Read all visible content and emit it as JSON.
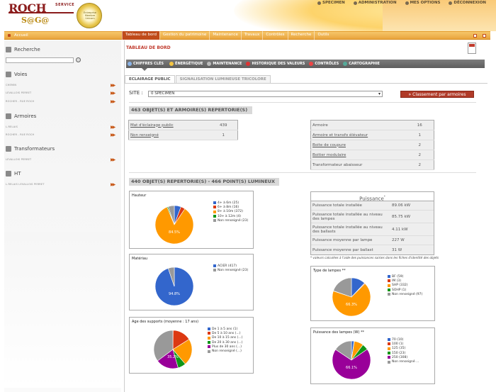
{
  "header": {
    "logo_main": "ROCH",
    "logo_service": "SERVICE",
    "logo_sub": "S@G@",
    "seal_text": "Entreprise Membre Unicom",
    "links": [
      "SPECIMEN",
      "ADMINISTRATION",
      "MES OPTIONS",
      "DÉCONNEXION"
    ]
  },
  "nav": {
    "home": "Accueil",
    "items": [
      "Tableau de bord",
      "Gestion du patrimoine",
      "Maintenance",
      "Travaux",
      "Contrôles",
      "Recherche",
      "Outils"
    ]
  },
  "sidebar": {
    "search_title": "Recherche",
    "sections": [
      {
        "title": "Voies",
        "items": [
          "CHEMIN",
          "LEVALLOIS PERRET",
          "ROCHER - RUE ROCH"
        ]
      },
      {
        "title": "Armoires",
        "items": [
          "L.RELAIS",
          "ROCHER - RUE ROCH"
        ]
      },
      {
        "title": "Transformateurs",
        "items": [
          "LEVALLOIS PERRET"
        ]
      },
      {
        "title": "HT",
        "items": [
          "L.RELAIS LEVALLOIS PERRET"
        ]
      }
    ]
  },
  "main": {
    "page_title": "TABLEAU DE BORD",
    "subtabs": [
      "CHIFFRES CLÉS",
      "ÉNERGÉTIQUE",
      "MAINTENANCE",
      "HISTORIQUE DES VALEURS",
      "CONTRÔLES",
      "CARTOGRAPHIE"
    ],
    "tabs": [
      "ECLAIRAGE PUBLIC",
      "SIGNALISATION LUMINEUSE TRICOLORE"
    ],
    "site_label": "SITE :",
    "site_value": "0 SPECIMEN",
    "classement_button": "Classement par armoires",
    "band1": "463 OBJET(S) ET ARMOIRE(S) REPERTORIE(S)",
    "band2": "440 OBJET(S) REPERTORIE(S) - 466 POINT(S) LUMINEUX",
    "table_left": [
      {
        "label": "Mat d'éclairage public",
        "value": "439"
      },
      {
        "label": "Non renseigné",
        "value": "1"
      }
    ],
    "table_right": [
      {
        "label": "Armoire",
        "value": "16"
      },
      {
        "label": "Armoire et transfo élévateur",
        "value": "1"
      },
      {
        "label": "Boite de coupure",
        "value": "2"
      },
      {
        "label": "Boitier modulaire",
        "value": "2"
      },
      {
        "label": "Transformateur abaisseur",
        "value": "2"
      }
    ],
    "puissance": {
      "title": "Puissance",
      "title_mark": "*",
      "rows": [
        {
          "label": "Puissance totale installée",
          "value": "89.06 kW"
        },
        {
          "label": "Puissance totale installée au niveau des lampes",
          "value": "85.75 kW"
        },
        {
          "label": "Puissance totale installée au niveau des ballasts",
          "value": "4.11 kW"
        },
        {
          "label": "Puissance moyenne par lampe",
          "value": "227 W"
        },
        {
          "label": "Puissance moyenne par ballast",
          "value": "31 W"
        }
      ],
      "note": "* valeurs calculées à l'aide des puissances saisies dans les fiches d'identité des objets"
    }
  },
  "colors": {
    "blue": "#3366cc",
    "red": "#dc3912",
    "orange": "#ff9900",
    "green": "#109618",
    "gray": "#999999",
    "purple": "#990099"
  },
  "chart_data": [
    {
      "type": "pie",
      "title": "Hauteur",
      "labels": [
        "4+ à 6m (25)",
        "6+ à 8m (16)",
        "8+ à 10m (372)",
        "10+ à 12m (4)",
        "Non renseigné (23)"
      ],
      "values": [
        25,
        16,
        372,
        4,
        23
      ],
      "center_label": "84.5%"
    },
    {
      "type": "pie",
      "title": "Matériau",
      "labels": [
        "ACIER (417)",
        "Non renseigné (23)"
      ],
      "values": [
        417,
        23
      ],
      "center_label": "94.8%"
    },
    {
      "type": "pie",
      "title": "Age des supports (moyenne : 17 ans)",
      "labels": [
        "De 1 à 5 ans (1)",
        "De 5 à 10 ans (...)",
        "De 10 à 15 ans (...)",
        "De 20 à 30 ans (...)",
        "Plus de 30 ans (...)",
        "Non renseigné (...)"
      ],
      "values": [
        1,
        70,
        100,
        30,
        85,
        155
      ],
      "center_label": "35.2%"
    },
    {
      "type": "pie",
      "title": "Type de lampes",
      "labels": [
        "BF (59)",
        "IM (3)",
        "SHP (332)",
        "SOHP (1)",
        "Non renseigné (97)"
      ],
      "values": [
        59,
        3,
        332,
        1,
        97
      ],
      "center_label": "66.3%"
    },
    {
      "type": "pie",
      "title": "Puissance des lampes (W)",
      "labels": [
        "70 (10)",
        "100 (1)",
        "125 (35)",
        "150 (23)",
        "250 (308)",
        "Non renseigné ..."
      ],
      "values": [
        10,
        1,
        35,
        23,
        308,
        70
      ],
      "center_label": "66.1%"
    }
  ]
}
